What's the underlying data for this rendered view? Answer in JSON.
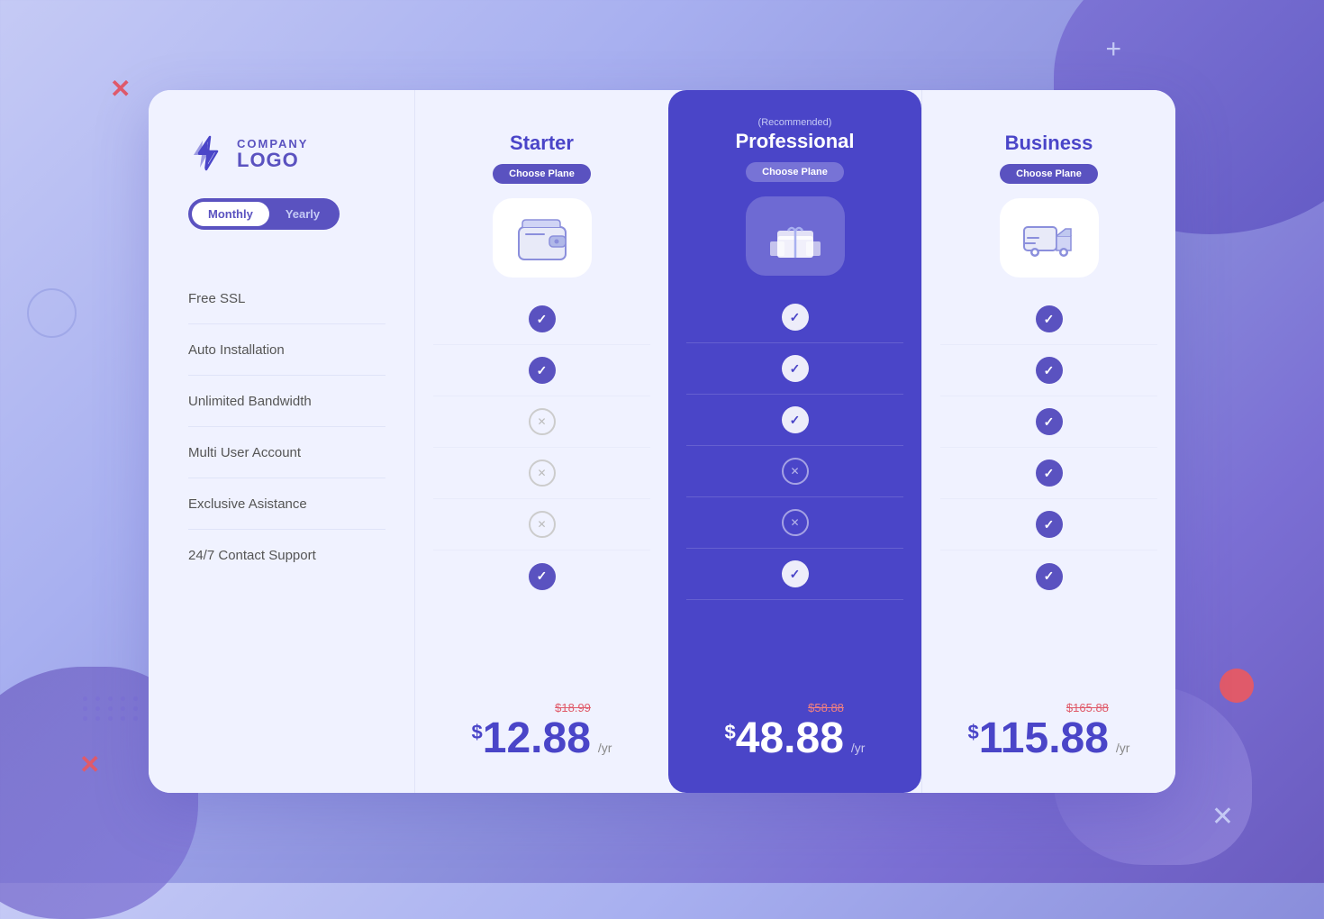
{
  "background": {
    "color_start": "#c5caf5",
    "color_end": "#6a5bbf"
  },
  "logo": {
    "company_label": "COMPANY",
    "name_label": "LOGO"
  },
  "billing_toggle": {
    "monthly_label": "Monthly",
    "yearly_label": "Yearly",
    "active": "monthly"
  },
  "features": [
    {
      "label": "Free SSL"
    },
    {
      "label": "Auto Installation"
    },
    {
      "label": "Unlimited Bandwidth"
    },
    {
      "label": "Multi User Account"
    },
    {
      "label": "Exclusive Asistance"
    },
    {
      "label": "24/7 Contact Support"
    }
  ],
  "plans": [
    {
      "id": "starter",
      "recommended_label": "",
      "name": "Starter",
      "choose_label": "Choose Plane",
      "icon": "wallet",
      "checks": [
        "yes",
        "yes",
        "no",
        "no",
        "no",
        "yes"
      ],
      "price_original": "$18.99",
      "price_main": "12.88",
      "price_dollar": "$",
      "price_per": "/yr"
    },
    {
      "id": "professional",
      "recommended_label": "(Recommended)",
      "name": "Professional",
      "choose_label": "Choose Plane",
      "icon": "gift",
      "checks": [
        "yes",
        "yes",
        "yes",
        "no",
        "no",
        "yes"
      ],
      "price_original": "$58.88",
      "price_main": "48.88",
      "price_dollar": "$",
      "price_per": "/yr"
    },
    {
      "id": "business",
      "recommended_label": "",
      "name": "Business",
      "choose_label": "Choose Plane",
      "icon": "truck",
      "checks": [
        "yes",
        "yes",
        "yes",
        "yes",
        "yes",
        "yes"
      ],
      "price_original": "$165.88",
      "price_main": "115.88",
      "price_dollar": "$",
      "price_per": "/yr"
    }
  ]
}
